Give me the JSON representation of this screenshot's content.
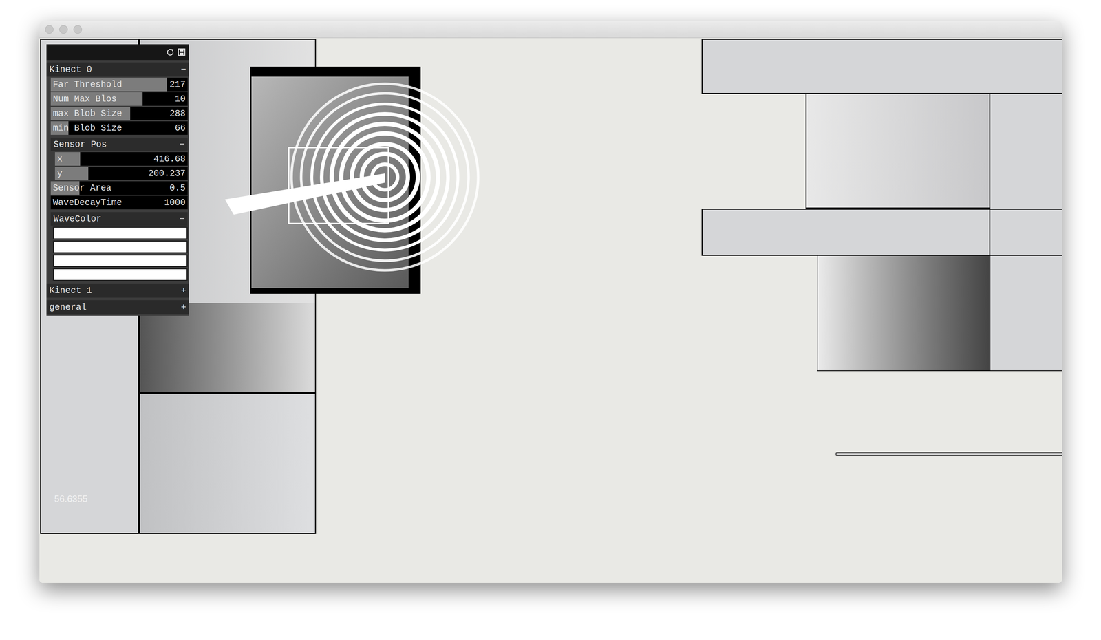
{
  "gui": {
    "groups": [
      {
        "label": "Kinect 0",
        "toggle": "−",
        "expanded": true,
        "items": [
          {
            "kind": "slider",
            "label": "Far Threshold",
            "value": "217",
            "level": 0.85
          },
          {
            "kind": "slider",
            "label": "Num Max Blos",
            "value": "10",
            "level": 0.67
          },
          {
            "kind": "slider",
            "label": "max Blob Size",
            "value": "288",
            "level": 0.58
          },
          {
            "kind": "slider",
            "label": "min Blob Size",
            "value": "66",
            "level": 0.13
          },
          {
            "kind": "group",
            "label": "Sensor Pos",
            "toggle": "−",
            "expanded": true,
            "items": [
              {
                "kind": "slider",
                "label": "x",
                "value": "416.68",
                "level": 0.19
              },
              {
                "kind": "slider",
                "label": "y",
                "value": "200.237",
                "level": 0.25
              }
            ]
          },
          {
            "kind": "slider",
            "label": "Sensor Area",
            "value": "0.5",
            "level": 0.21
          },
          {
            "kind": "slider",
            "label": "WaveDecayTime",
            "value": "1000",
            "level": 0
          },
          {
            "kind": "group",
            "label": "WaveColor",
            "toggle": "−",
            "expanded": true,
            "items": [
              {
                "kind": "color",
                "level": 1
              },
              {
                "kind": "color",
                "level": 1
              },
              {
                "kind": "color",
                "level": 1
              },
              {
                "kind": "color",
                "level": 1
              }
            ]
          }
        ]
      },
      {
        "label": "Kinect 1",
        "toggle": "+",
        "expanded": false,
        "items": []
      },
      {
        "label": "general",
        "toggle": "+",
        "expanded": false,
        "items": []
      }
    ]
  },
  "canvas": {
    "fps": "56.6355"
  }
}
